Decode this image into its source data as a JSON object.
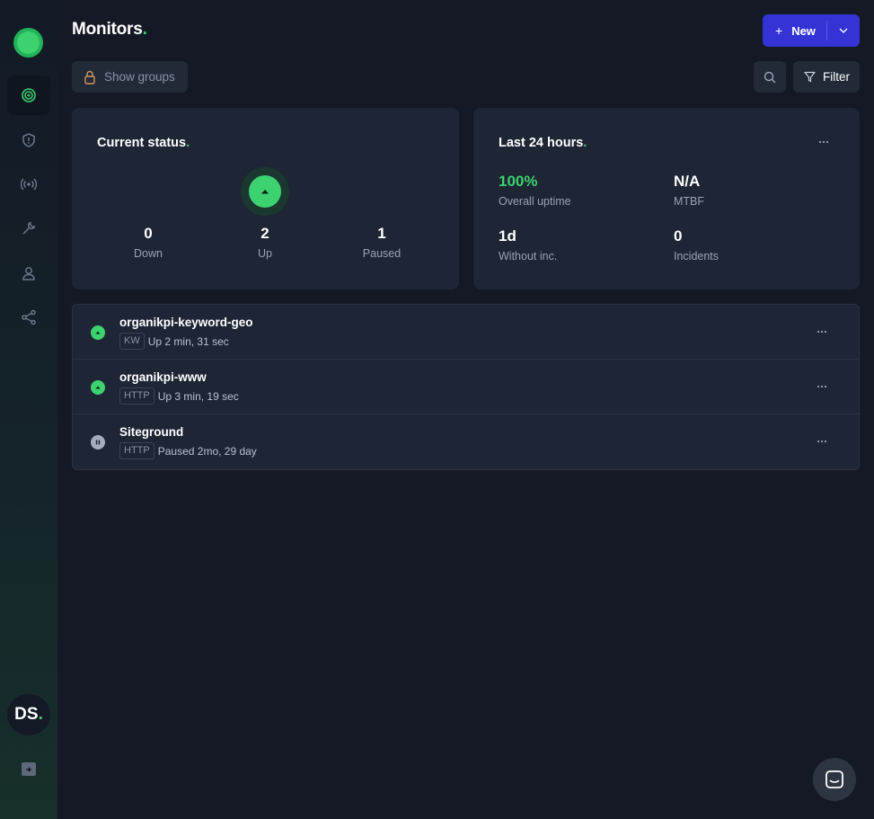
{
  "header": {
    "title": "Monitors",
    "new_label": "New"
  },
  "toolbar": {
    "show_groups_label": "Show groups",
    "filter_label": "Filter"
  },
  "sidebar": {
    "items": [
      {
        "icon": "monitors-icon",
        "active": true
      },
      {
        "icon": "shield-icon",
        "active": false
      },
      {
        "icon": "broadcast-icon",
        "active": false
      },
      {
        "icon": "wrench-icon",
        "active": false
      },
      {
        "icon": "user-icon",
        "active": false
      },
      {
        "icon": "share-icon",
        "active": false
      }
    ],
    "avatar_initials": "DS"
  },
  "current_status": {
    "title": "Current status",
    "stats": [
      {
        "value": "0",
        "label": "Down"
      },
      {
        "value": "2",
        "label": "Up"
      },
      {
        "value": "1",
        "label": "Paused"
      }
    ]
  },
  "last24": {
    "title": "Last 24 hours",
    "metrics": [
      {
        "value": "100%",
        "label": "Overall uptime"
      },
      {
        "value": "N/A",
        "label": "MTBF"
      },
      {
        "value": "1d",
        "label": "Without inc."
      },
      {
        "value": "0",
        "label": "Incidents"
      }
    ]
  },
  "monitors": [
    {
      "name": "organikpi-keyword-geo",
      "type": "KW",
      "status": "up",
      "status_text": "Up 2 min, 31 sec"
    },
    {
      "name": "organikpi-www",
      "type": "HTTP",
      "status": "up",
      "status_text": "Up 3 min, 19 sec"
    },
    {
      "name": "Siteground",
      "type": "HTTP",
      "status": "paused",
      "status_text": "Paused 2mo, 29 day"
    }
  ],
  "colors": {
    "accent": "#3433d6",
    "up": "#3bd26f",
    "paused": "#a3adbd",
    "background": "#141925",
    "card": "#1e2534"
  }
}
